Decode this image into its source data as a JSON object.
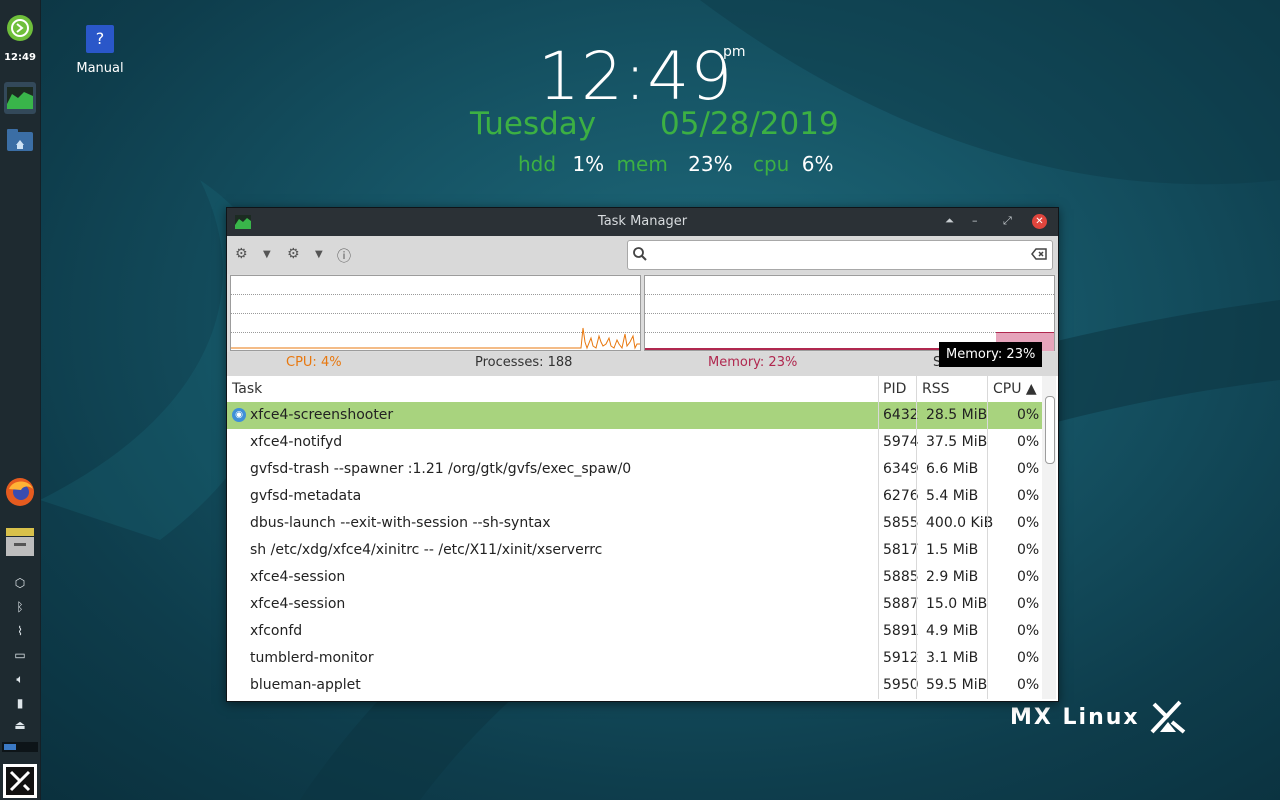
{
  "panel": {
    "clock": "12:49",
    "icons": [
      "whisker-menu-icon",
      "task-manager-icon",
      "file-manager-icon",
      "firefox-icon",
      "drawer-icon",
      "package-icon",
      "bluetooth-icon",
      "clipboard-icon",
      "network-icon",
      "volume-icon",
      "power-icon",
      "eject-icon",
      "workspace-icon",
      "mx-menu-icon"
    ]
  },
  "desktop": {
    "manual_label": "Manual",
    "manual_glyph": "?"
  },
  "conky": {
    "time": "12:49",
    "ampm": "pm",
    "day": "Tuesday",
    "date": "05/28/2019",
    "hdd_label": "hdd",
    "hdd_value": "1%",
    "mem_label": "mem",
    "mem_value": "23%",
    "cpu_label": "cpu",
    "cpu_value": "6%"
  },
  "logo": {
    "text": "MX Linux"
  },
  "window": {
    "title": "Task Manager",
    "status": {
      "cpu": "CPU: 4%",
      "processes": "Processes: 188",
      "memory": "Memory: 23%",
      "swap_partial": "S"
    },
    "tooltip": "Memory: 23%",
    "search_placeholder": "",
    "columns": {
      "task": "Task",
      "pid": "PID",
      "rss": "RSS",
      "cpu": "CPU ▲"
    },
    "rows": [
      {
        "task": "xfce4-screenshooter",
        "pid": "6432",
        "rss": "28.5 MiB",
        "cpu": "0%"
      },
      {
        "task": "xfce4-notifyd",
        "pid": "5974",
        "rss": "37.5 MiB",
        "cpu": "0%"
      },
      {
        "task": "gvfsd-trash --spawner :1.21 /org/gtk/gvfs/exec_spaw/0",
        "pid": "6349",
        "rss": "6.6 MiB",
        "cpu": "0%"
      },
      {
        "task": "gvfsd-metadata",
        "pid": "6276",
        "rss": "5.4 MiB",
        "cpu": "0%"
      },
      {
        "task": "dbus-launch --exit-with-session --sh-syntax",
        "pid": "5855",
        "rss": "400.0 KiB",
        "cpu": "0%"
      },
      {
        "task": "sh /etc/xdg/xfce4/xinitrc -- /etc/X11/xinit/xserverrc",
        "pid": "5817",
        "rss": "1.5 MiB",
        "cpu": "0%"
      },
      {
        "task": "xfce4-session",
        "pid": "5885",
        "rss": "2.9 MiB",
        "cpu": "0%"
      },
      {
        "task": "xfce4-session",
        "pid": "5887",
        "rss": "15.0 MiB",
        "cpu": "0%"
      },
      {
        "task": "xfconfd",
        "pid": "5891",
        "rss": "4.9 MiB",
        "cpu": "0%"
      },
      {
        "task": "tumblerd-monitor",
        "pid": "5912",
        "rss": "3.1 MiB",
        "cpu": "0%"
      },
      {
        "task": "blueman-applet",
        "pid": "5950",
        "rss": "59.5 MiB",
        "cpu": "0%"
      }
    ]
  },
  "colors": {
    "conky_green": "#3cb043",
    "selected_row": "#a8d37e",
    "cpu_orange": "#e8780f",
    "mem_pink": "#b0284f"
  }
}
